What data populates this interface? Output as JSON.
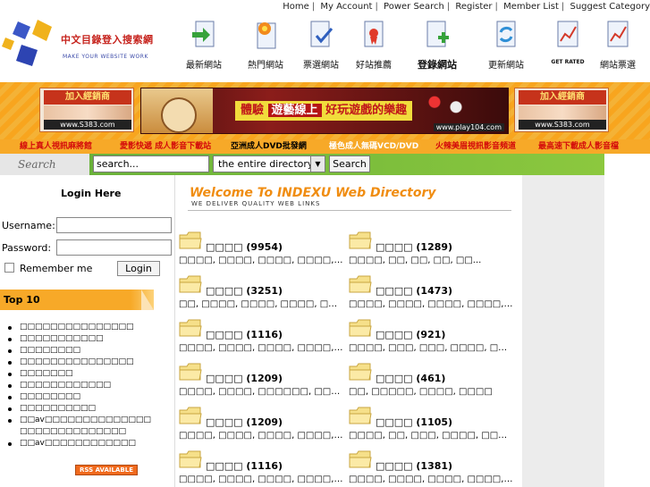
{
  "top_links": [
    "Home",
    "My Account",
    "Power Search",
    "Register",
    "Member List",
    "Suggest Category"
  ],
  "logo": {
    "title": "中文目錄登入搜索網",
    "subtitle": "make your website work"
  },
  "nav": [
    {
      "label": "最新網站",
      "icon": "arrow-page-icon"
    },
    {
      "label": "熱門網站",
      "icon": "hot-page-icon"
    },
    {
      "label": "票選網站",
      "icon": "check-page-icon"
    },
    {
      "label": "好站推薦",
      "icon": "award-page-icon"
    },
    {
      "label": "登錄網站",
      "icon": "add-page-icon"
    },
    {
      "label": "更新網站",
      "icon": "refresh-page-icon"
    },
    {
      "label": "GET RATED",
      "icon": "chart-page-icon"
    },
    {
      "label": "網站票選",
      "icon": "chart-page-icon"
    }
  ],
  "banner": {
    "left": {
      "tag": "加入經銷商",
      "url": "www.S383.com"
    },
    "center": {
      "slogan_a": "體驗",
      "slogan_b": "遊藝線上",
      "slogan_c": "好玩遊戲的樂趣",
      "url": "www.play104.com"
    },
    "right": {
      "tag": "加入經銷商",
      "url": "www.S383.com"
    }
  },
  "link_bar": [
    {
      "text": "線上真人視訊麻將館",
      "color": "red"
    },
    {
      "text": "愛影快遞 成人影音下載站",
      "color": "red"
    },
    {
      "text": "亞洲成人DVD批發網",
      "color": "black"
    },
    {
      "text": "極色成人無碼VCD/DVD",
      "color": "white"
    },
    {
      "text": "火辣美眉視訊影音頻道",
      "color": "red"
    },
    {
      "text": "最高速下載成人影音檔",
      "color": "red"
    }
  ],
  "search": {
    "label": "Search",
    "value": "search...",
    "scope": "the entire directory",
    "button": "Search"
  },
  "login": {
    "title": "Login Here",
    "username_label": "Username:",
    "password_label": "Password:",
    "remember_label": "Remember me",
    "button": "Login"
  },
  "top10": {
    "title": "Top 10",
    "items": [
      "□□□□□□□□□□□□□□□",
      "□□□□□□□□□□□",
      "□□□□□□□□",
      "□□□□□□□□□□□□□□□",
      "□□□□□□□",
      "□□□□□□□□□□□□",
      "□□□□□□□□",
      "□□□□□□□□□□",
      "□□av□□□□□□□□□□□□□□□□□□□□□□□□□□□□",
      "□□av□□□□□□□□□□□□"
    ],
    "rss": "RSS AVAILABLE"
  },
  "welcome": {
    "title": "Welcome To INDEXU Web Directory",
    "tagline": "we deliver quality web links"
  },
  "categories": [
    {
      "name": "□□□□ (9954)",
      "subs": "□□□□, □□□□, □□□□, □□□□, □□□□..."
    },
    {
      "name": "□□□□ (1289)",
      "subs": "□□□□, □□, □□, □□, □□..."
    },
    {
      "name": "□□□□ (3251)",
      "subs": "□□, □□□□, □□□□, □□□□, □□□□..."
    },
    {
      "name": "□□□□ (1473)",
      "subs": "□□□□, □□□□, □□□□, □□□□, □□□□..."
    },
    {
      "name": "□□□□ (1116)",
      "subs": "□□□□, □□□□, □□□□, □□□□, □□□□..."
    },
    {
      "name": "□□□□ (921)",
      "subs": "□□□□, □□□, □□□, □□□□, □□□□..."
    },
    {
      "name": "□□□□ (1209)",
      "subs": "□□□□, □□□□, □□□□□□, □□□□, □□□□..."
    },
    {
      "name": "□□□□ (461)",
      "subs": "□□, □□□□□, □□□□, □□□□"
    },
    {
      "name": "□□□□ (1209)",
      "subs": "□□□□, □□□□, □□□□, □□□□, □□□□..."
    },
    {
      "name": "□□□□ (1105)",
      "subs": "□□□□, □□, □□□, □□□□, □□□□..."
    },
    {
      "name": "□□□□ (1116)",
      "subs": "□□□□, □□□□, □□□□, □□□□, □□□□..."
    },
    {
      "name": "□□□□ (1381)",
      "subs": "□□□□, □□□□, □□□□, □□□□, □□□□..."
    }
  ]
}
